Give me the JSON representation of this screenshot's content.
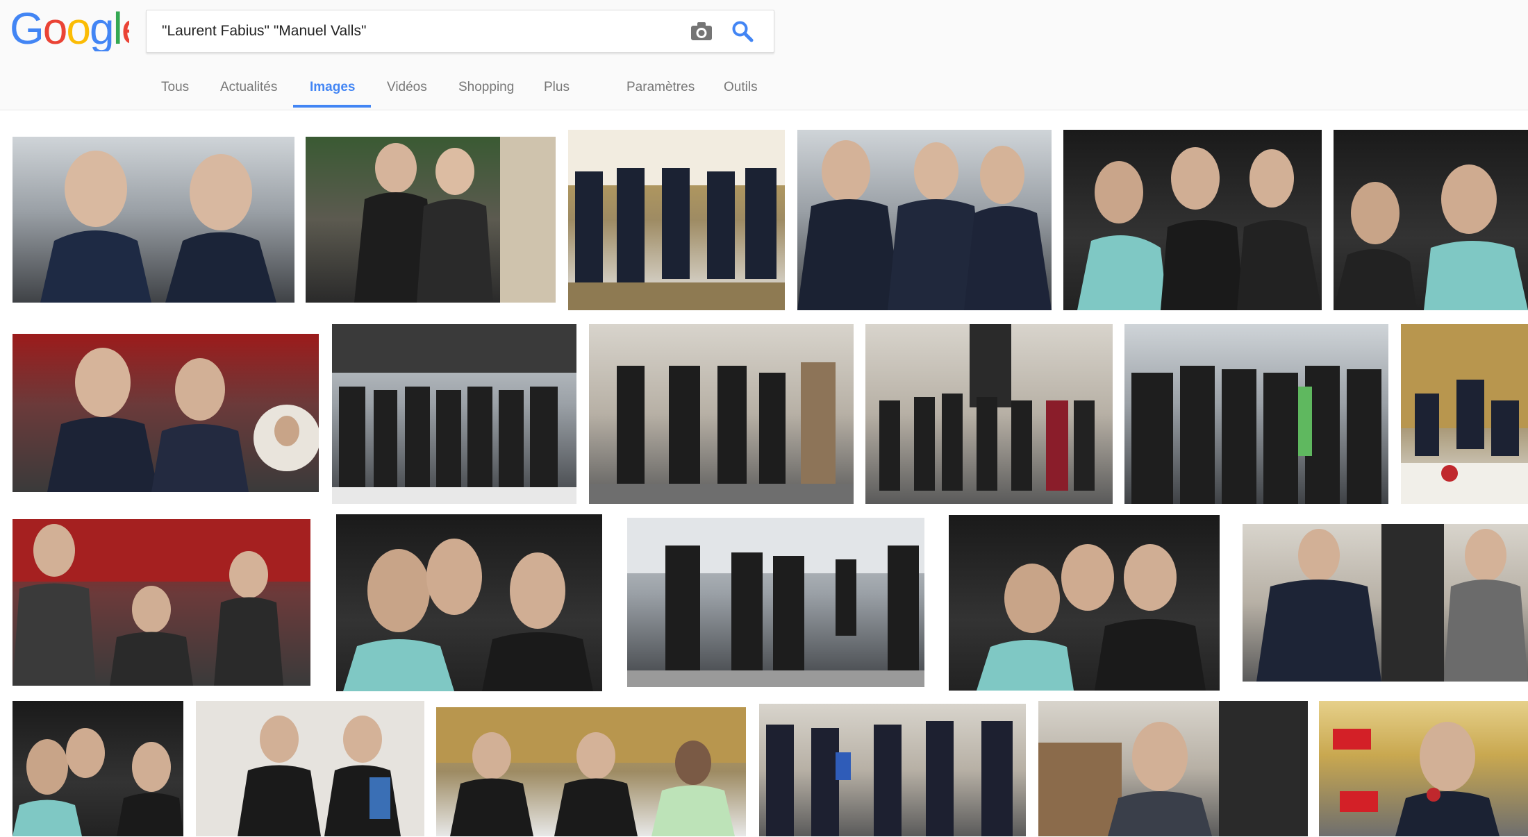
{
  "logo": {
    "text": "Google",
    "alt": "Google logo"
  },
  "search": {
    "query": "\"Laurent Fabius\" \"Manuel Valls\"",
    "camera_icon": "camera-icon",
    "search_icon": "search-icon"
  },
  "tabs": [
    {
      "label": "Tous",
      "active": false
    },
    {
      "label": "Actualités",
      "active": false
    },
    {
      "label": "Images",
      "active": true
    },
    {
      "label": "Vidéos",
      "active": false
    },
    {
      "label": "Shopping",
      "active": false
    },
    {
      "label": "Plus",
      "active": false
    },
    {
      "label": "Paramètres",
      "active": false
    },
    {
      "label": "Outils",
      "active": false
    }
  ],
  "colors": {
    "accent": "#4285f4",
    "tab_text": "#777777",
    "header_bg": "#fafafa"
  },
  "results": [
    {
      "alt": "Manuel Valls et Laurent Fabius souriant"
    },
    {
      "alt": "Laurent Fabius et Manuel Valls dans une cour"
    },
    {
      "alt": "Groupe de ministres dans un salon"
    },
    {
      "alt": "Fabius, Valls et Hollande"
    },
    {
      "alt": "Ministres assis au premier rang"
    },
    {
      "alt": "Ministres assis, gros plan"
    },
    {
      "alt": "Fabius et Valls à l'Assemblée nationale"
    },
    {
      "alt": "Gouvernement devant une façade"
    },
    {
      "alt": "Ministres marchant dans une cour"
    },
    {
      "alt": "Groupe devant un palais"
    },
    {
      "alt": "Foule de ministres en manteaux"
    },
    {
      "alt": "Salle à manger dorée"
    },
    {
      "alt": "Discussion sur les bancs de l'Assemblée"
    },
    {
      "alt": "Ministres de profil sur fond noir"
    },
    {
      "alt": "Marche sur un quai"
    },
    {
      "alt": "Ministres assis, fond noir"
    },
    {
      "alt": "Fabius et Valls debout"
    },
    {
      "alt": "Ministres sur fond noir"
    },
    {
      "alt": "Hollande et Valls discutant"
    },
    {
      "alt": "Ministres à une table dorée"
    },
    {
      "alt": "Sortie du Conseil des ministres"
    },
    {
      "alt": "Valls à l'Assemblée"
    },
    {
      "alt": "Laurent Fabius au micro RTL"
    }
  ]
}
